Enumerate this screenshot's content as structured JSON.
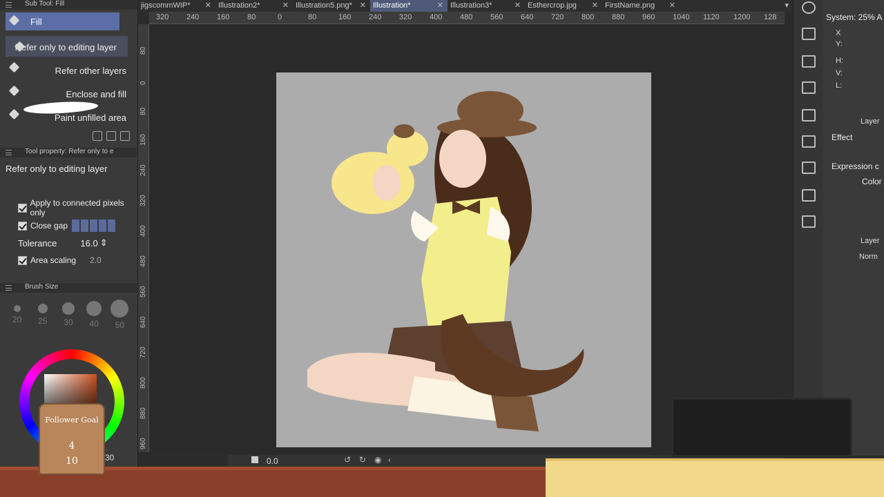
{
  "left_panel": {
    "subtool_title": "Sub Tool: Fill",
    "subtools": [
      {
        "label": "Fill"
      },
      {
        "label": "Refer only to editing layer"
      },
      {
        "label": "Refer other layers"
      },
      {
        "label": "Enclose and fill"
      },
      {
        "label": "Paint unfilled area"
      }
    ],
    "tool_property_title": "Tool property: Refer only to e",
    "tool_property_name": "Refer only to editing layer",
    "apply_connected": "Apply to connected pixels only",
    "close_gap": "Close gap",
    "tolerance_label": "Tolerance",
    "tolerance_value": "16.0",
    "area_scaling": "Area scaling",
    "area_scaling_value": "2.0",
    "brush_size_title": "Brush Size",
    "brush_sizes": [
      "20",
      "25",
      "30",
      "40",
      "50"
    ]
  },
  "tabs": [
    {
      "label": "jigscommWIP*"
    },
    {
      "label": "Illustration2*"
    },
    {
      "label": "Illustration5.png*"
    },
    {
      "label": "Illustration*",
      "active": true
    },
    {
      "label": "Illustration3*"
    },
    {
      "label": "Esthercrop.jpg"
    },
    {
      "label": "FirstName.png"
    }
  ],
  "ruler_top": [
    "320",
    "240",
    "160",
    "80",
    "0",
    "80",
    "160",
    "240",
    "320",
    "400",
    "480",
    "560",
    "640",
    "720",
    "800",
    "880",
    "960",
    "1040",
    "1120",
    "1200",
    "128"
  ],
  "ruler_left": [
    "80",
    "0",
    "80",
    "160",
    "240",
    "320",
    "400",
    "480",
    "560",
    "640",
    "720",
    "800",
    "880",
    "960"
  ],
  "footer": {
    "coordinate": "0.0"
  },
  "right_panel": {
    "system": "System: 25% A",
    "x": "X",
    "y": "Y:",
    "h": "H:",
    "v": "V:",
    "l": "L:",
    "layer_tab": "Layer",
    "effect": "Effect",
    "expression": "Expression c",
    "color": "Color",
    "layer_tab2": "Layer",
    "blend_mode": "Norm"
  },
  "overlay": {
    "goal_title": "Follower Goal",
    "goal_current": "4",
    "goal_target": "10",
    "side_number": "30"
  }
}
